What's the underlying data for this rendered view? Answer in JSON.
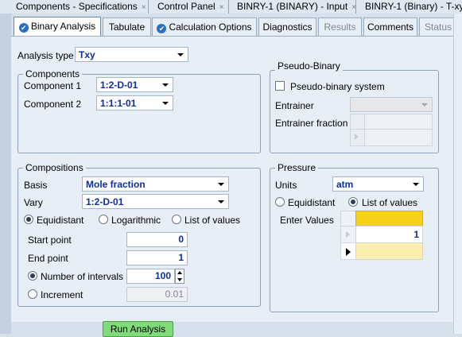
{
  "doc_tabs": [
    {
      "label": "Components - Specifications",
      "close": "×"
    },
    {
      "label": "Control Panel",
      "close": "×"
    },
    {
      "label": "BINRY-1 (BINARY) - Input",
      "close": "×"
    },
    {
      "label": "BINRY-1 (Binary) - T-xy",
      "close": ""
    }
  ],
  "tabs": [
    {
      "label": "Binary Analysis",
      "state": "active",
      "icon": "check-circle-icon"
    },
    {
      "label": "Tabulate",
      "state": "normal"
    },
    {
      "label": "Calculation Options",
      "state": "normal",
      "icon": "check-circle-icon"
    },
    {
      "label": "Diagnostics",
      "state": "normal"
    },
    {
      "label": "Results",
      "state": "disabled"
    },
    {
      "label": "Comments",
      "state": "normal"
    },
    {
      "label": "Status",
      "state": "disabled"
    }
  ],
  "analysis": {
    "label": "Analysis type",
    "value": "Txy"
  },
  "components": {
    "title": "Components",
    "comp1_label": "Component 1",
    "comp1_value": "1:2-D-01",
    "comp2_label": "Component 2",
    "comp2_value": "1:1:1-01"
  },
  "pseudo": {
    "title": "Pseudo-Binary",
    "checkbox_label": "Pseudo-binary system",
    "checkbox_checked": false,
    "entrainer_label": "Entrainer",
    "entrainer_fraction_label": "Entrainer fraction"
  },
  "compositions": {
    "title": "Compositions",
    "basis_label": "Basis",
    "basis_value": "Mole fraction",
    "vary_label": "Vary",
    "vary_value": "1:2-D-01",
    "mode_options": [
      "Equidistant",
      "Logarithmic",
      "List of values"
    ],
    "mode_selected": "Equidistant",
    "start_label": "Start point",
    "start_value": "0",
    "end_label": "End point",
    "end_value": "1",
    "step_options": [
      "Number of intervals",
      "Increment"
    ],
    "step_selected": "Number of intervals",
    "intervals_value": "100",
    "increment_value": "0.01"
  },
  "pressure": {
    "title": "Pressure",
    "units_label": "Units",
    "units_value": "atm",
    "mode_options": [
      "Equidistant",
      "List of values"
    ],
    "mode_selected": "List of values",
    "enter_values_label": "Enter Values",
    "values": [
      "1"
    ],
    "header_color": "#f7d21c",
    "active_row_color": "#faefb0"
  },
  "run_button": {
    "label": "Run Analysis",
    "color": "#7fdc78"
  }
}
